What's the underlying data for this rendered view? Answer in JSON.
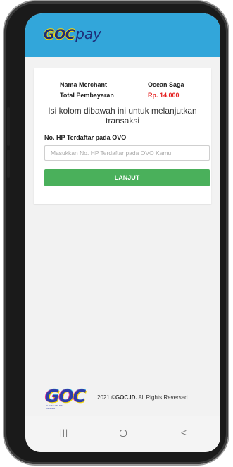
{
  "header": {
    "logo_goc": "GOC",
    "logo_pay": "pay"
  },
  "payment": {
    "merchant_label": "Nama Merchant",
    "merchant_value": "Ocean Saga",
    "total_label": "Total Pembayaran",
    "total_value": "Rp. 14.000",
    "instruction": "Isi kolom dibawah ini untuk melanjutkan transaksi",
    "field_label": "No. HP Terdaftar pada OVO",
    "field_placeholder": "Masukkan No. HP Terdaftar pada OVO Kamu",
    "field_value": "",
    "submit_label": "LANJUT"
  },
  "footer": {
    "logo_text": "GOC",
    "logo_subtext": "GAMES ONLINE CENTER",
    "copyright_prefix": "2021 ©",
    "copyright_brand": "GOC.ID.",
    "copyright_suffix": " All Rights Reversed"
  },
  "navbar": {
    "recent_icon": "recent-apps-icon",
    "home_icon": "home-icon",
    "back_icon": "back-icon"
  },
  "colors": {
    "header": "#32a6da",
    "button": "#4ab05b",
    "total": "#e41f1f",
    "brand": "#1e2d7a"
  }
}
